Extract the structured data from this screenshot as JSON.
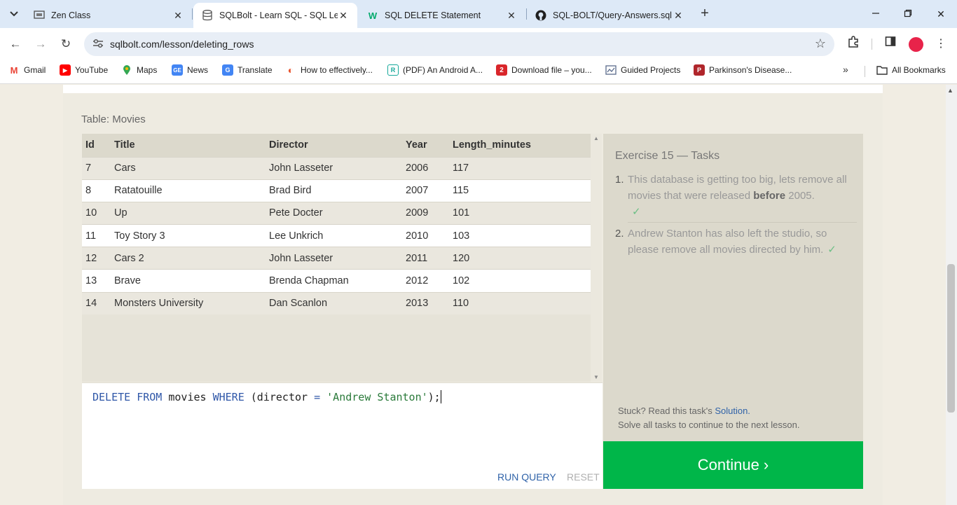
{
  "browser": {
    "tabs": [
      {
        "title": "Zen Class",
        "active": false
      },
      {
        "title": "SQLBolt - Learn SQL - SQL Less",
        "active": true
      },
      {
        "title": "SQL DELETE Statement",
        "active": false
      },
      {
        "title": "SQL-BOLT/Query-Answers.sql a",
        "active": false
      }
    ],
    "url": "sqlbolt.com/lesson/deleting_rows",
    "bookmarks": [
      {
        "label": "Gmail",
        "icon": "gmail-icon",
        "color": "#ea4335"
      },
      {
        "label": "YouTube",
        "icon": "youtube-icon",
        "color": "#ff0000"
      },
      {
        "label": "Maps",
        "icon": "maps-icon",
        "color": "#34a853"
      },
      {
        "label": "News",
        "icon": "news-icon",
        "color": "#4285f4"
      },
      {
        "label": "Translate",
        "icon": "translate-icon",
        "color": "#4285f4"
      },
      {
        "label": "How to effectively...",
        "icon": "site-icon",
        "color": "#e8532c"
      },
      {
        "label": "(PDF) An Android A...",
        "icon": "researchgate-icon",
        "color": "#16a89a"
      },
      {
        "label": "Download file – you...",
        "icon": "download-icon",
        "color": "#d9262b"
      },
      {
        "label": "Guided Projects",
        "icon": "projects-icon",
        "color": "#5a6b8c"
      },
      {
        "label": "Parkinson's Disease...",
        "icon": "site-icon",
        "color": "#b0262b"
      }
    ],
    "all_bookmarks": "All Bookmarks"
  },
  "lesson": {
    "table_caption": "Table: Movies",
    "columns": [
      "Id",
      "Title",
      "Director",
      "Year",
      "Length_minutes"
    ],
    "rows": [
      [
        "7",
        "Cars",
        "John Lasseter",
        "2006",
        "117"
      ],
      [
        "8",
        "Ratatouille",
        "Brad Bird",
        "2007",
        "115"
      ],
      [
        "10",
        "Up",
        "Pete Docter",
        "2009",
        "101"
      ],
      [
        "11",
        "Toy Story 3",
        "Lee Unkrich",
        "2010",
        "103"
      ],
      [
        "12",
        "Cars 2",
        "John Lasseter",
        "2011",
        "120"
      ],
      [
        "13",
        "Brave",
        "Brenda Chapman",
        "2012",
        "102"
      ],
      [
        "14",
        "Monsters University",
        "Dan Scanlon",
        "2013",
        "110"
      ]
    ],
    "query": {
      "kw_delete": "DELETE",
      "kw_from": "FROM",
      "table": "movies",
      "kw_where": "WHERE",
      "open": "(director",
      "op": "=",
      "value": "'Andrew Stanton'",
      "close": ");"
    },
    "run_label": "RUN QUERY",
    "reset_label": "RESET"
  },
  "tasks": {
    "title": "Exercise 15 — Tasks",
    "items": [
      {
        "num": "1.",
        "before": "This database is getting too big, lets remove all movies that were released ",
        "bold": "before",
        "after": " 2005.",
        "check": "✓"
      },
      {
        "num": "2.",
        "text": "Andrew Stanton has also left the studio, so please remove all movies directed by him.",
        "check": "✓"
      }
    ],
    "stuck_prefix": "Stuck? Read this task's ",
    "solution_link": "Solution.",
    "stuck_line2": "Solve all tasks to continue to the next lesson.",
    "continue_label": "Continue ›"
  },
  "colors": {
    "continue": "#00b649",
    "keyword": "#2f57a8",
    "string": "#2a7a3a"
  }
}
